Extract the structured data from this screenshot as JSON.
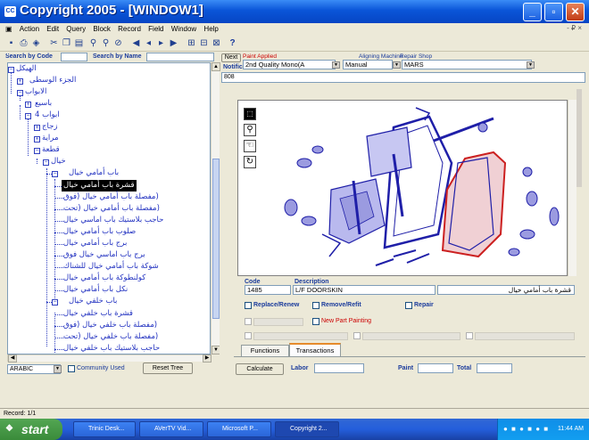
{
  "window": {
    "title": "Copyright 2005  - [WINDOW1]",
    "app_icon": "CC"
  },
  "menu": [
    "Action",
    "Edit",
    "Query",
    "Block",
    "Record",
    "Field",
    "Window",
    "Help"
  ],
  "mdi_controls": "- ₽ ×",
  "search": {
    "by_code_label": "Search by Code",
    "by_name_label": "Search by Name",
    "code_value": "",
    "name_value": ""
  },
  "header": {
    "next_button": "Next",
    "notification_label": "Notification",
    "paint_applied_label": "Paint Applied",
    "paint_applied_value": "2nd Quality Mono(A",
    "aligning_label": "Aligning Machine",
    "aligning_value": "Manual",
    "repair_shop_label": "Repair Shop",
    "repair_shop_value": "MARS",
    "notification_value": "808"
  },
  "tree": {
    "nodes": [
      "الهيكل",
      "الجزء الوسطى",
      "الابواب",
      "باسيع",
      "ابواب 4",
      "زجاج",
      "مراية",
      "قطعة",
      "خيال",
      "باب أمامي خيال",
      "قشرة باب أمامي خيال",
      "(مفصلة باب أمامي خيال (فوق",
      "(مفصلة باب أمامي خيال (تحت",
      "حاجب بلاستيك باب اماسي خيال",
      "صلوب باب أمامي خيال",
      "برج باب أمامي خيال",
      "برج باب اماسي خيال فوق",
      "شوكة باب أمامي خيال للشناك",
      "كولنطوكة باب أمامي خيال",
      "نكل باب أمامي خيال",
      "باب خلفي خيال",
      "قشرة باب خلفي خيال",
      "(مفصلة باب خلفي خيال (فوق",
      "(مفصلة باب خلفي خيال (تحت",
      "حاجب بلاستيك باب خلفي خيال"
    ]
  },
  "bottom_left": {
    "language_value": "ARABIC",
    "community_used_label": "Community Used",
    "reset_tree_label": "Reset Tree"
  },
  "part": {
    "code_label": "Code",
    "description_label": "Description",
    "code_value": "1485",
    "description_value": "L/F DOORSKIN",
    "arabic_value": "قشرة باب أمامي خيال"
  },
  "options": {
    "replace_renew": "Replace/Renew",
    "remove_refit": "Remove/Refit",
    "repair": "Repair",
    "new_part_painting": "New Part Painting"
  },
  "tabs": [
    "Functions",
    "Transactions"
  ],
  "totals": {
    "calculate_button": "Calculate",
    "labor_label": "Labor",
    "paint_label": "Paint",
    "total_label": "Total"
  },
  "status": {
    "record": "Record: 1/1"
  },
  "taskbar": {
    "start_label": "start",
    "tasks": [
      "Trinic Desk...",
      "AVerTV Vid...",
      "Microsoft P...",
      "Copyright 2..."
    ],
    "clock": "11:44 AM"
  },
  "colors": {
    "titlebar": "#0a55d8",
    "tree_text": "#2030c0",
    "label_blue": "#1a3b9c",
    "paint_applied_red": "#cc0000",
    "diagram_highlight_red": "#cc2020"
  }
}
